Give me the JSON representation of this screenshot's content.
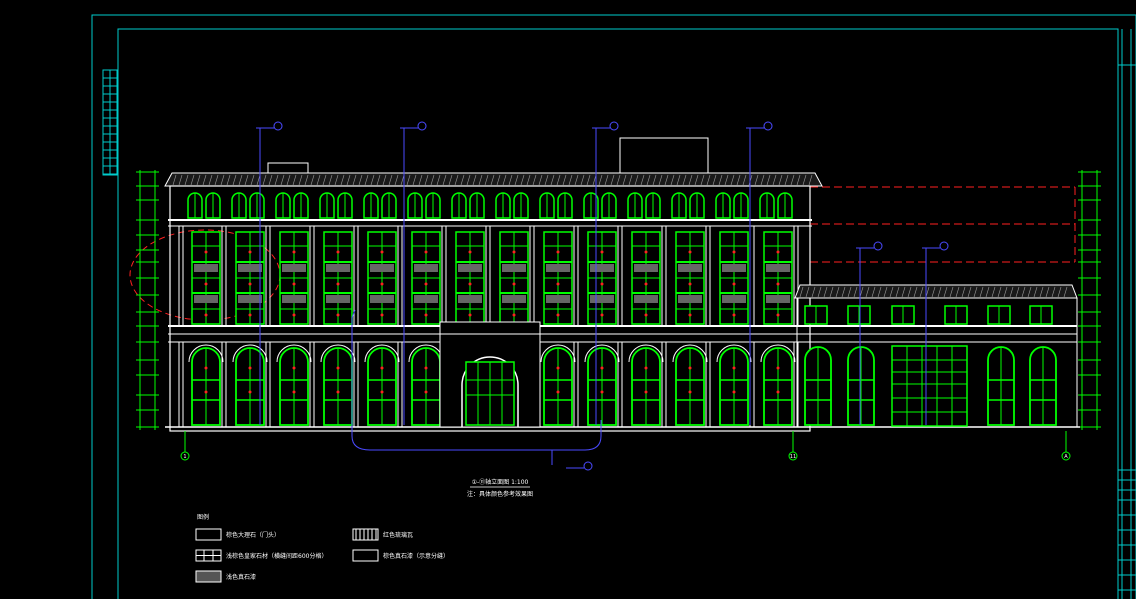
{
  "drawing": {
    "title": "①-⑪轴立面图 1:100",
    "note": "注：具体颜色参考效果图",
    "legend_heading": "图例",
    "legend": [
      {
        "label": "棕色大理石（门头）"
      },
      {
        "label": "浅棕色皇家石材（横缝间距600分格）"
      },
      {
        "label": "浅色真石漆"
      },
      {
        "label": "红色琉璃瓦"
      },
      {
        "label": "棕色真石漆（示意分缝）"
      }
    ],
    "axes": {
      "left": "1",
      "mid": "11",
      "right": "A"
    },
    "colors": {
      "background": "#000000",
      "frame": "#00cccc",
      "linework": "#ffffff",
      "glazing": "#00ff00",
      "guides": "#ff0000",
      "leaders": "#4a4aff"
    }
  }
}
